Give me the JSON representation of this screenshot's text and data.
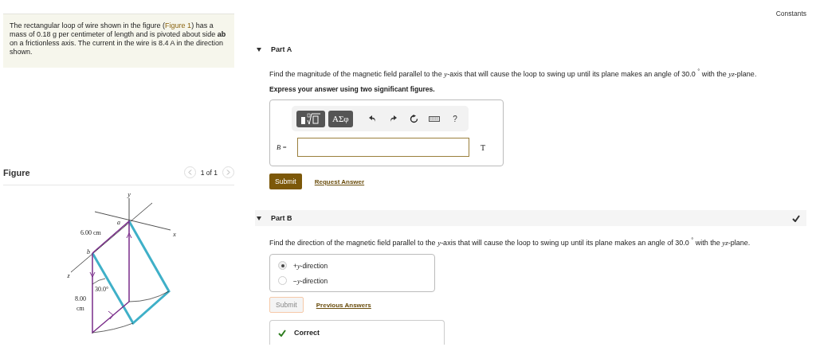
{
  "problem": {
    "text_before": "The rectangular loop of wire shown in the figure (",
    "link": "Figure 1",
    "text_after": ") has a mass of 0.18 g per centimeter of length and is pivoted about side **ab** on a frictionless axis. The current in the wire is 8.4 A in the direction shown."
  },
  "figure": {
    "title": "Figure",
    "pager": "1 of 1",
    "labels": [
      "y",
      "a",
      "x",
      "6.00 cm",
      "b",
      "z",
      "30.0°",
      "8.00",
      "cm"
    ]
  },
  "constants": "Constants",
  "part_a": {
    "title": "Part A",
    "expanded": true,
    "question": "Find the magnitude of the magnetic field parallel to the *y*-axis that will cause the loop to swing up until its plane makes an angle of 30.0 $^{°}$ with the *yz*-plane.",
    "instruction": "Express your answer using two significant figures.",
    "toolbar": {
      "symbols": "ΑΣφ",
      "help": "?"
    },
    "answer_label": "B =",
    "unit": "T",
    "submit": "Submit",
    "link": "Request Answer"
  },
  "part_b": {
    "title": "Part B",
    "expanded": true,
    "complete": true,
    "question": "Find the direction of the magnetic field parallel to the *y*-axis that will cause the loop to swing up until its plane makes an angle of 30.0 $^{°}$ with the *yz*-plane.",
    "options": [
      {
        "label": "+*y*-direction",
        "selected": true
      },
      {
        "label": "−*y*-direction",
        "selected": false
      }
    ],
    "submit": "Submit",
    "submit_disabled": true,
    "link": "Previous Answers",
    "feedback": "Correct"
  }
}
